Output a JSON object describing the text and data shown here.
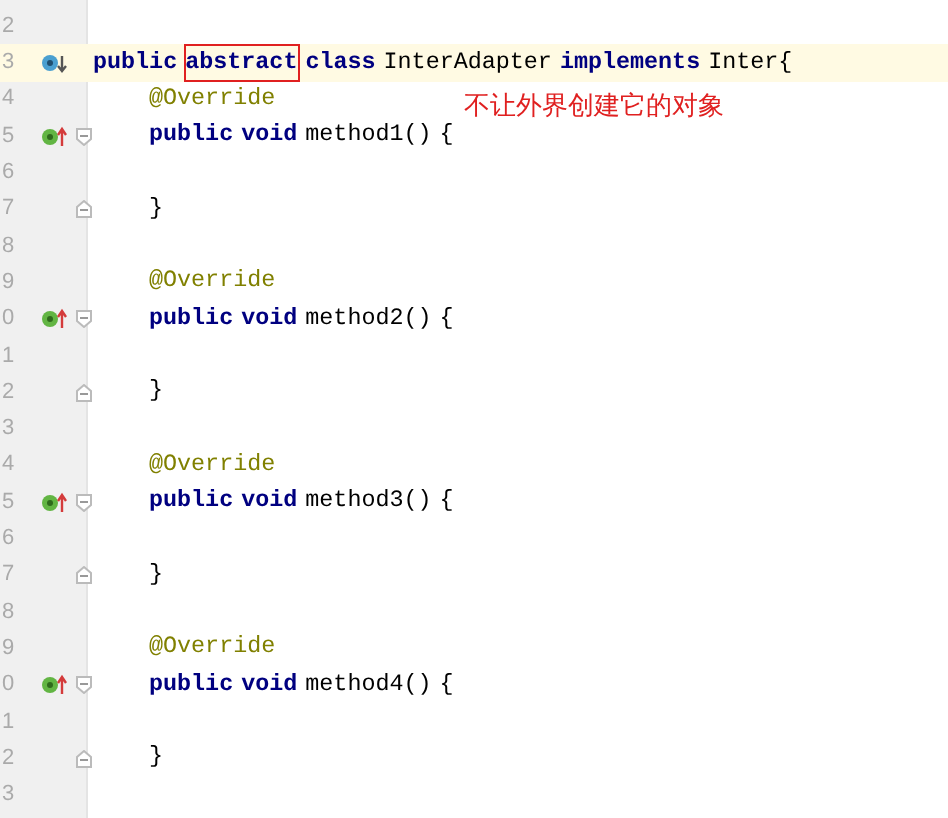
{
  "lines": [
    {
      "number": "2",
      "current": false
    },
    {
      "number": "3",
      "current": true,
      "gutter": [
        {
          "kind": "implements"
        }
      ],
      "tokens": [
        {
          "kind": "keyword",
          "text": "public",
          "boxed": false
        },
        {
          "kind": "keyword",
          "text": "abstract",
          "boxed": true
        },
        {
          "kind": "keyword",
          "text": "class",
          "boxed": false
        },
        {
          "kind": "plain",
          "text": "InterAdapter",
          "boxed": false
        },
        {
          "kind": "keyword",
          "text": "implements",
          "boxed": false
        },
        {
          "kind": "plain",
          "text": "Inter{",
          "boxed": false
        }
      ]
    },
    {
      "number": "4",
      "current": false,
      "indent": true,
      "tokens": [
        {
          "kind": "annotation",
          "text": "@Override",
          "boxed": false
        }
      ],
      "note": "不让外界创建它的对象"
    },
    {
      "number": "5",
      "current": false,
      "gutter": [
        {
          "kind": "overrides"
        },
        {
          "kind": "fold_open"
        }
      ],
      "indent": true,
      "tokens": [
        {
          "kind": "keyword",
          "text": "public",
          "boxed": false
        },
        {
          "kind": "keyword",
          "text": "void",
          "boxed": false
        },
        {
          "kind": "plain",
          "text": "method1()",
          "boxed": false
        },
        {
          "kind": "plain",
          "text": "{",
          "boxed": false
        }
      ]
    },
    {
      "number": "6",
      "current": false
    },
    {
      "number": "7",
      "current": false,
      "gutter": [
        {
          "kind": "fold_close"
        }
      ],
      "indent": true,
      "tokens": [
        {
          "kind": "plain",
          "text": "}",
          "boxed": false
        }
      ]
    },
    {
      "number": "8",
      "current": false
    },
    {
      "number": "9",
      "current": false,
      "indent": true,
      "tokens": [
        {
          "kind": "annotation",
          "text": "@Override",
          "boxed": false
        }
      ]
    },
    {
      "number": "0",
      "current": false,
      "gutter": [
        {
          "kind": "overrides"
        },
        {
          "kind": "fold_open"
        }
      ],
      "indent": true,
      "tokens": [
        {
          "kind": "keyword",
          "text": "public",
          "boxed": false
        },
        {
          "kind": "keyword",
          "text": "void",
          "boxed": false
        },
        {
          "kind": "plain",
          "text": "method2()",
          "boxed": false
        },
        {
          "kind": "plain",
          "text": "{",
          "boxed": false
        }
      ]
    },
    {
      "number": "1",
      "current": false
    },
    {
      "number": "2",
      "current": false,
      "gutter": [
        {
          "kind": "fold_close"
        }
      ],
      "indent": true,
      "tokens": [
        {
          "kind": "plain",
          "text": "}",
          "boxed": false
        }
      ]
    },
    {
      "number": "3",
      "current": false
    },
    {
      "number": "4",
      "current": false,
      "indent": true,
      "tokens": [
        {
          "kind": "annotation",
          "text": "@Override",
          "boxed": false
        }
      ]
    },
    {
      "number": "5",
      "current": false,
      "gutter": [
        {
          "kind": "overrides"
        },
        {
          "kind": "fold_open"
        }
      ],
      "indent": true,
      "tokens": [
        {
          "kind": "keyword",
          "text": "public",
          "boxed": false
        },
        {
          "kind": "keyword",
          "text": "void",
          "boxed": false
        },
        {
          "kind": "plain",
          "text": "method3()",
          "boxed": false
        },
        {
          "kind": "plain",
          "text": "{",
          "boxed": false
        }
      ]
    },
    {
      "number": "6",
      "current": false
    },
    {
      "number": "7",
      "current": false,
      "gutter": [
        {
          "kind": "fold_close"
        }
      ],
      "indent": true,
      "tokens": [
        {
          "kind": "plain",
          "text": "}",
          "boxed": false
        }
      ]
    },
    {
      "number": "8",
      "current": false
    },
    {
      "number": "9",
      "current": false,
      "indent": true,
      "tokens": [
        {
          "kind": "annotation",
          "text": "@Override",
          "boxed": false
        }
      ]
    },
    {
      "number": "0",
      "current": false,
      "gutter": [
        {
          "kind": "overrides"
        },
        {
          "kind": "fold_open"
        }
      ],
      "indent": true,
      "tokens": [
        {
          "kind": "keyword",
          "text": "public",
          "boxed": false
        },
        {
          "kind": "keyword",
          "text": "void",
          "boxed": false
        },
        {
          "kind": "plain",
          "text": "method4()",
          "boxed": false
        },
        {
          "kind": "plain",
          "text": "{",
          "boxed": false
        }
      ]
    },
    {
      "number": "1",
      "current": false
    },
    {
      "number": "2",
      "current": false,
      "gutter": [
        {
          "kind": "fold_close"
        }
      ],
      "indent": true,
      "tokens": [
        {
          "kind": "plain",
          "text": "}",
          "boxed": false
        }
      ]
    },
    {
      "number": "3",
      "current": false
    }
  ]
}
